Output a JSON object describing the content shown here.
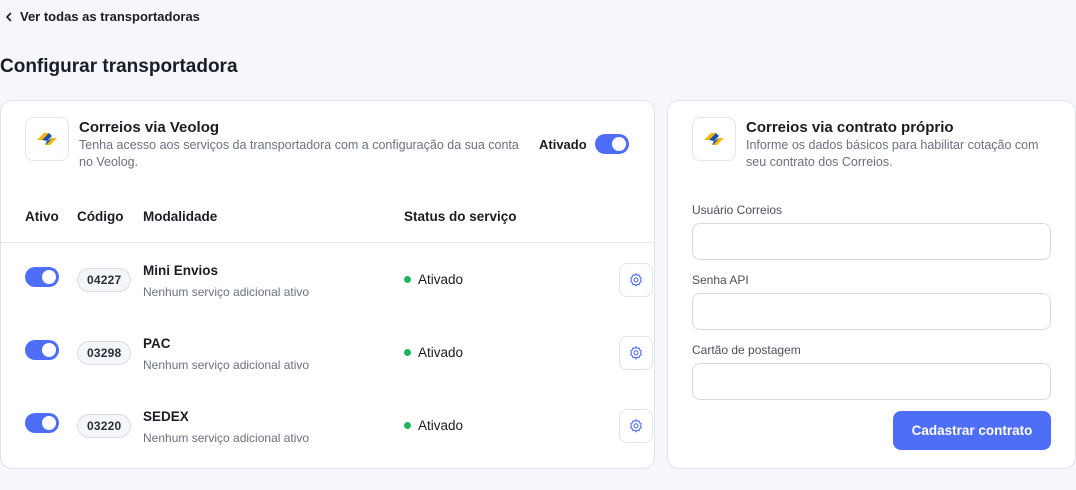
{
  "nav": {
    "back_label": "Ver todas as transportadoras"
  },
  "page": {
    "title": "Configurar transportadora"
  },
  "veolog": {
    "name": "Correios via Veolog",
    "description": "Tenha acesso aos serviços da transportadora com a configuração da sua conta no Veolog.",
    "toggle_label": "Ativado",
    "enabled": true,
    "table": {
      "headers": {
        "active": "Ativo",
        "code": "Código",
        "modality": "Modalidade",
        "status": "Status do serviço"
      },
      "rows": [
        {
          "enabled": true,
          "code": "04227",
          "name": "Mini Envios",
          "subtitle": "Nenhum serviço adicional ativo",
          "status": "Ativado"
        },
        {
          "enabled": true,
          "code": "03298",
          "name": "PAC",
          "subtitle": "Nenhum serviço adicional ativo",
          "status": "Ativado"
        },
        {
          "enabled": true,
          "code": "03220",
          "name": "SEDEX",
          "subtitle": "Nenhum serviço adicional ativo",
          "status": "Ativado"
        }
      ]
    }
  },
  "contract": {
    "name": "Correios via contrato próprio",
    "description": "Informe os dados básicos para habilitar cotação com seu contrato dos Correios.",
    "fields": {
      "user": {
        "label": "Usuário Correios",
        "value": ""
      },
      "api_password": {
        "label": "Senha API",
        "value": ""
      },
      "posting_card": {
        "label": "Cartão de postagem",
        "value": ""
      }
    },
    "submit_label": "Cadastrar contrato"
  },
  "colors": {
    "accent": "#4f6ef7",
    "status_active": "#22b55a",
    "logo_yellow": "#f5b800",
    "logo_blue": "#1d4fa8"
  },
  "icons": {
    "back": "chevron-left-icon",
    "settings": "gear-icon",
    "logo": "correios-logo-icon"
  }
}
